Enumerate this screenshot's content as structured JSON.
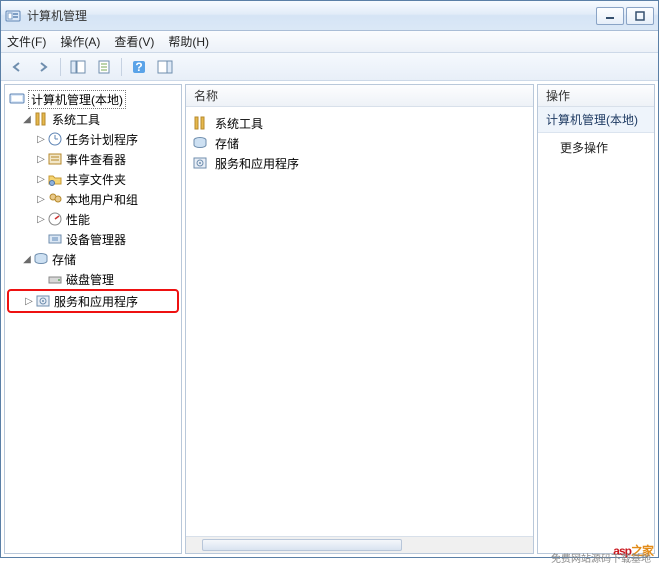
{
  "title": "计算机管理",
  "menu": {
    "file": "文件(F)",
    "action": "操作(A)",
    "view": "查看(V)",
    "help": "帮助(H)"
  },
  "columns": {
    "name": "名称",
    "actions": "操作"
  },
  "tree": {
    "root": "计算机管理(本地)",
    "system_tools": "系统工具",
    "task_scheduler": "任务计划程序",
    "event_viewer": "事件查看器",
    "shared_folders": "共享文件夹",
    "local_users": "本地用户和组",
    "performance": "性能",
    "device_manager": "设备管理器",
    "storage": "存储",
    "disk_mgmt": "磁盘管理",
    "services_apps": "服务和应用程序"
  },
  "list": {
    "system_tools": "系统工具",
    "storage": "存储",
    "services_apps": "服务和应用程序"
  },
  "actions": {
    "group": "计算机管理(本地)",
    "more": "更多操作"
  },
  "watermark": {
    "text_a": "asp",
    "text_b": "之家",
    "sub": "免费网站源码下载基地"
  }
}
